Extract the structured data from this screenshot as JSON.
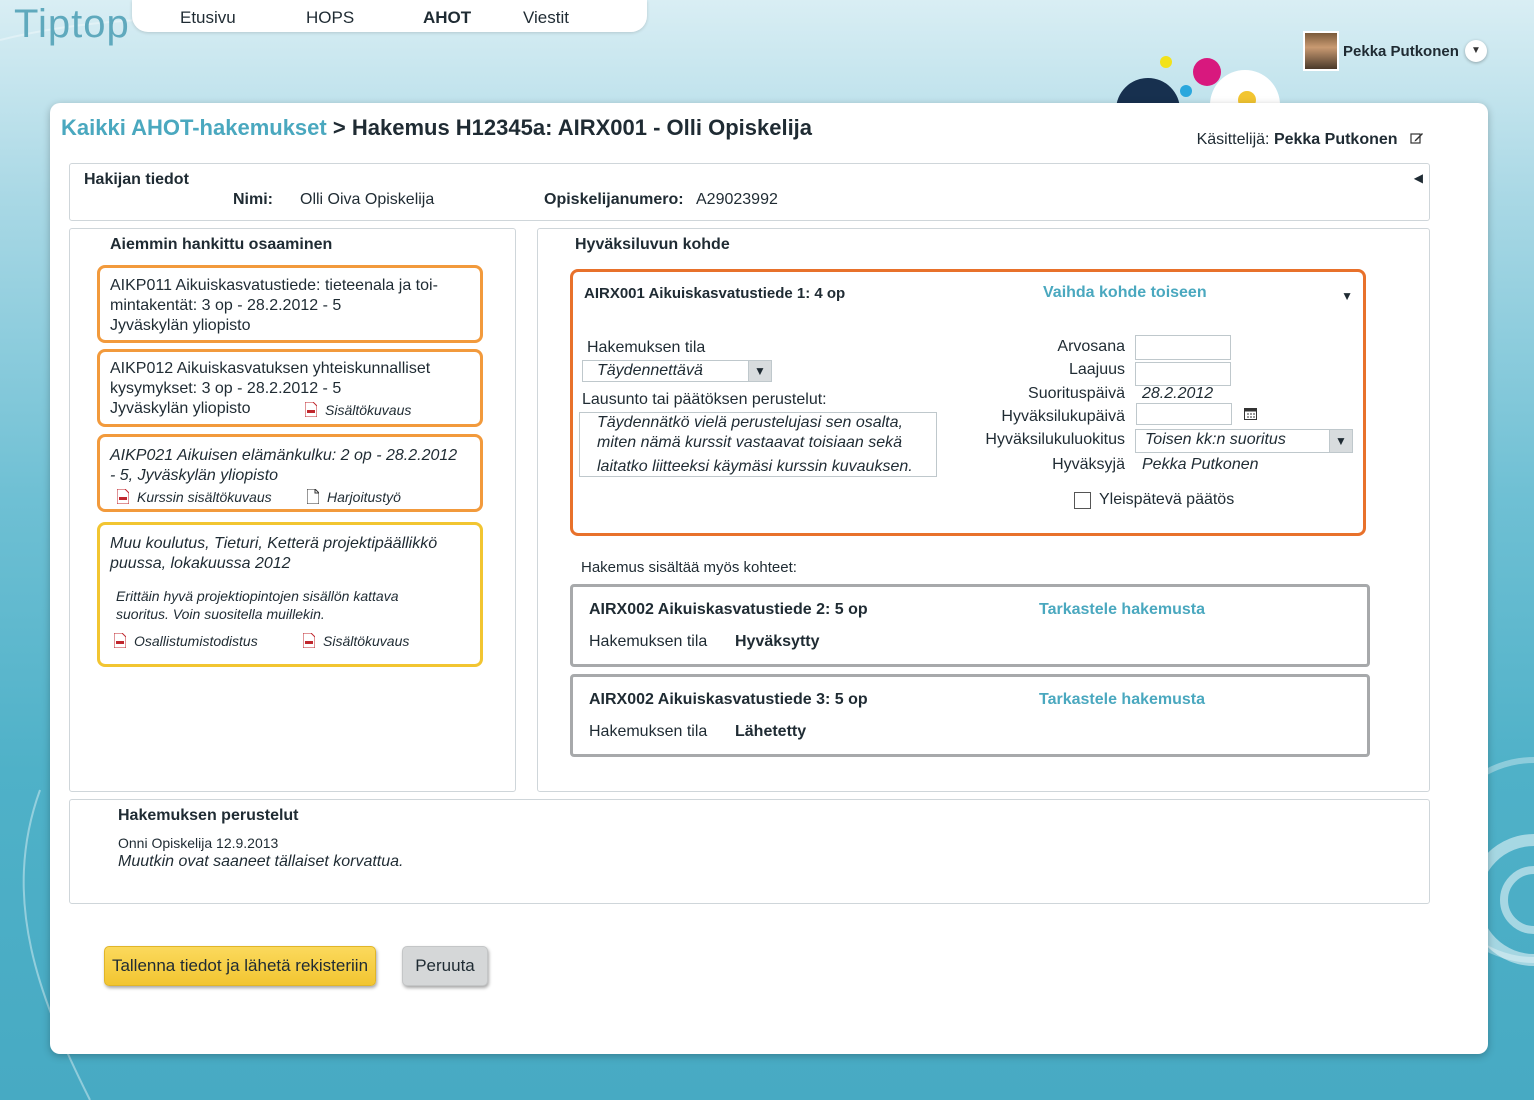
{
  "app": {
    "logo": "Tiptop"
  },
  "nav": {
    "items": [
      "Etusivu",
      "HOPS",
      "AHOT",
      "Viestit"
    ],
    "active": "AHOT"
  },
  "user": {
    "name": "Pekka Putkonen"
  },
  "breadcrumb": {
    "link": "Kaikki AHOT-hakemukset",
    "separator": ">",
    "current": "Hakemus H12345a: AIRX001 - Olli Opiskelija"
  },
  "handler": {
    "label": "Käsittelijä:",
    "name": "Pekka Putkonen"
  },
  "applicant": {
    "heading": "Hakijan tiedot",
    "name_label": "Nimi:",
    "name_value": "Olli Oiva Opiskelija",
    "number_label": "Opiskelijanumero:",
    "number_value": "A29023992"
  },
  "prior": {
    "heading": "Aiemmin hankittu osaaminen",
    "cards": [
      {
        "line1": "AIKP011 Aikuiskasvatustiede: tieteenala ja toi-",
        "line2": "mintakentät: 3 op - 28.2.2012 - 5",
        "line3": "Jyväskylän yliopisto"
      },
      {
        "line1": "AIKP012 Aikuiskasvatuksen yhteiskunnalliset",
        "line2": "kysymykset: 3 op - 28.2.2012 - 5",
        "line3": "Jyväskylän yliopisto",
        "att1": "Sisältökuvaus"
      },
      {
        "line1": "AIKP021 Aikuisen elämänkulku: 2 op - 28.2.2012",
        "line2": "- 5, Jyväskylän yliopisto",
        "att1": "Kurssin sisältökuvaus",
        "att2": "Harjoitustyö"
      },
      {
        "line1": "Muu koulutus, Tieturi, Ketterä projektipäällikkö",
        "line2": "puussa, lokakuussa 2012",
        "desc1": "Erittäin hyvä projektiopintojen sisällön kattava",
        "desc2": "suoritus. Voin suositella muillekin.",
        "att1": "Osallistumistodistus",
        "att2": "Sisältökuvaus"
      }
    ]
  },
  "target": {
    "heading": "Hyväksiluvun kohde",
    "course": "AIRX001 Aikuiskasvatustiede 1: 4 op",
    "change_link": "Vaihda kohde toiseen",
    "status_label": "Hakemuksen tila",
    "status_value": "Täydennettävä",
    "statement_label": "Lausunto tai päätöksen perustelut:",
    "statement_lines": [
      "Täydennätkö vielä perustelujasi sen osalta,",
      "miten nämä kurssit vastaavat toisiaan sekä",
      "laitatko liitteeksi käymäsi kurssin kuvauksen."
    ],
    "grade_label": "Arvosana",
    "scope_label": "Laajuus",
    "completion_label": "Suorituspäivä",
    "completion_value": "28.2.2012",
    "accept_date_label": "Hyväksilukupäivä",
    "class_label": "Hyväksilukuluokitus",
    "class_value": "Toisen kk:n suoritus",
    "approver_label": "Hyväksyjä",
    "approver_value": "Pekka Putkonen",
    "general_label": "Yleispätevä päätös"
  },
  "also": {
    "heading": "Hakemus sisältää myös kohteet:",
    "items": [
      {
        "course": "AIRX002 Aikuiskasvatustiede 2: 5 op",
        "link": "Tarkastele hakemusta",
        "status_label": "Hakemuksen tila",
        "status_value": "Hyväksytty"
      },
      {
        "course": "AIRX002 Aikuiskasvatustiede 3: 5 op",
        "link": "Tarkastele hakemusta",
        "status_label": "Hakemuksen tila",
        "status_value": "Lähetetty"
      }
    ]
  },
  "rationale": {
    "heading": "Hakemuksen perustelut",
    "author": "Onni Opiskelija 12.9.2013",
    "text": "Muutkin ovat saaneet tällaiset korvattua."
  },
  "buttons": {
    "save": "Tallenna tiedot ja lähetä rekisteriin",
    "cancel": "Peruuta"
  }
}
